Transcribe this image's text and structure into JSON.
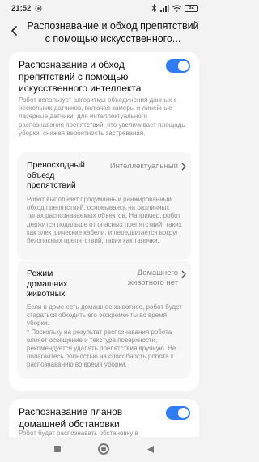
{
  "status_bar": {
    "time": "21:52",
    "battery": "62",
    "icons": [
      "notification-icon",
      "bluetooth-icon",
      "signal-icon",
      "wifi-icon",
      "battery-icon"
    ]
  },
  "header": {
    "title": "Распознавание и обход препятствий с помощью искусственного..."
  },
  "main_setting": {
    "title": "Распознавание и обход препятствий с помощью искусственного интеллекта",
    "toggle_on": true,
    "description": "Робот использует алгоритмы объединения данных с нескольких датчиков, включая камеры и линейные лазерные датчики, для интеллектуального распознавания препятствий, что увеличивает площадь уборки, снижая вероятность застревания."
  },
  "obstacle_mode": {
    "title": "Превосходный объезд препятствий",
    "value": "Интеллектуальный",
    "description": "Робот выполняет продуманный ранжированный обход препятствий, основываясь на различных типах распознаваемых объектов. Например, робот держится подальше от опасных препятствий, таких как электрические кабели, и передвигается вокруг безопасных препятствий, таких как тапочки."
  },
  "pet_mode": {
    "title": "Режим домашних животных",
    "value": "Домашнего животного нет",
    "description": "Если в доме есть домашнее животное, робот будет стараться обходить его экскременты во время уборки.\n* Поскольку на результат распознавания робота влияет освещение и текстура поверхности, рекомендуется удалять препятствия вручную. Не полагайтесь полностью на способность робота к распознаванию во время уборки."
  },
  "home_layout": {
    "title": "Распознавание планов домашней обстановки",
    "toggle_on": true,
    "description": "Робот будет распознавать обстановку в"
  },
  "colors": {
    "accent": "#2f7df6",
    "background": "#f3f3f3",
    "card": "#ffffff"
  }
}
